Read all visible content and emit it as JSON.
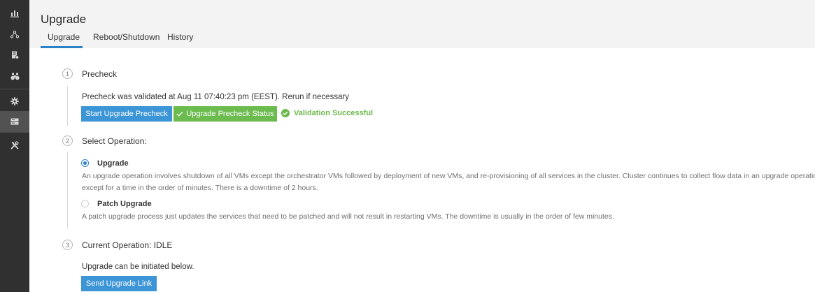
{
  "sidebar": {
    "items": [
      {
        "icon": "bar-chart-icon"
      },
      {
        "icon": "topology-icon"
      },
      {
        "icon": "inventory-icon"
      },
      {
        "icon": "binoculars-icon"
      },
      {
        "icon": "gear-icon"
      },
      {
        "icon": "server-icon",
        "active": true
      },
      {
        "icon": "tools-icon"
      }
    ]
  },
  "header": {
    "title": "Upgrade",
    "tabs": [
      {
        "label": "Upgrade",
        "active": true
      },
      {
        "label": "Reboot/Shutdown"
      },
      {
        "label": "History"
      }
    ]
  },
  "steps": [
    {
      "number": "1",
      "title": "Precheck",
      "message": "Precheck was validated at Aug 11 07:40:23 pm (EEST). Rerun if necessary",
      "start_button": "Start Upgrade Precheck",
      "status_button": "Upgrade Precheck Status",
      "validation": "Validation Successful"
    },
    {
      "number": "2",
      "title": "Select Operation:",
      "options": [
        {
          "label": "Upgrade",
          "selected": true,
          "desc_line1": "An upgrade operation involves shutdown of all VMs except the orchestrator VMs followed by deployment of new VMs, and re-provisioning of all services in the cluster. Cluster continues to collect flow data in an upgrade operation",
          "desc_line2": "except for a time in the order of minutes. There is a downtime of 2 hours."
        },
        {
          "label": "Patch Upgrade",
          "selected": false,
          "desc_line1": "A patch upgrade process just updates the services that need to be patched and will not result in restarting VMs. The downtime is usually in the order of few minutes."
        }
      ]
    },
    {
      "number": "3",
      "title": "Current Operation: IDLE",
      "message": "Upgrade can be initiated below.",
      "button": "Send Upgrade Link"
    }
  ],
  "colors": {
    "sidebar_bg": "#303030",
    "accent_blue": "#3b95d6",
    "success_green": "#6cbb4f"
  }
}
